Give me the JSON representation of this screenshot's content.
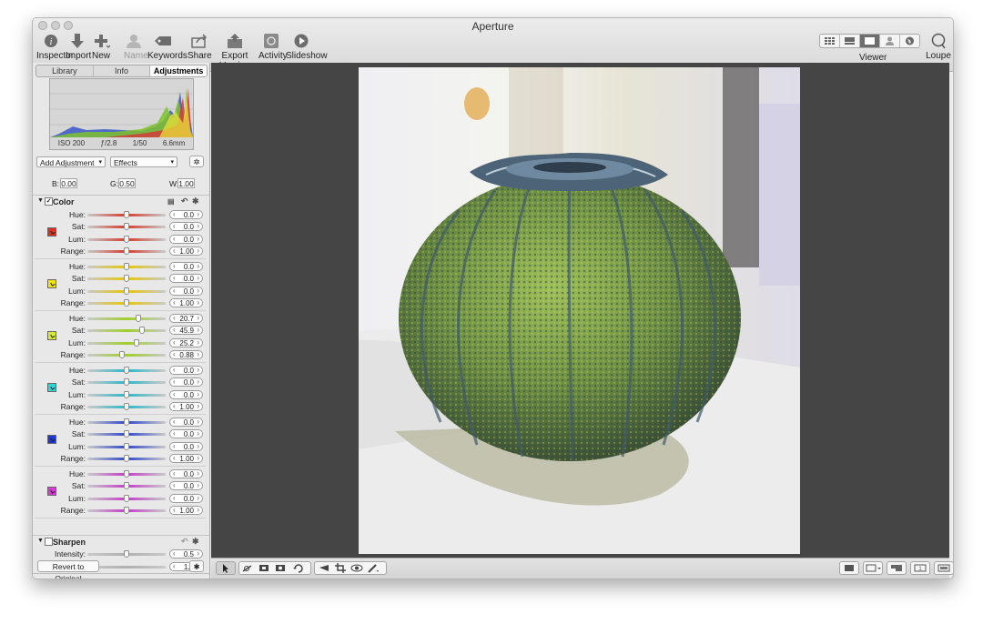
{
  "window": {
    "title": "Aperture"
  },
  "toolbar": {
    "left_items": [
      {
        "label": "Inspector",
        "icon": "info-icon"
      },
      {
        "label": "Import",
        "icon": "import-arrow-icon"
      },
      {
        "label": "New",
        "icon": "plus-icon"
      },
      {
        "label": "Name",
        "icon": "person-icon"
      },
      {
        "label": "Keywords",
        "icon": "tag-icon"
      }
    ],
    "right_items": [
      {
        "label": "Share",
        "icon": "share-icon"
      },
      {
        "label": "Export Version",
        "icon": "export-icon"
      },
      {
        "label": "Activity",
        "icon": "activity-icon"
      },
      {
        "label": "Slideshow",
        "icon": "play-icon"
      }
    ],
    "viewer_label": "Viewer",
    "loupe_label": "Loupe"
  },
  "inspector": {
    "tabs": [
      "Library",
      "Info",
      "Adjustments"
    ],
    "selected_tab": "Adjustments",
    "histogram": {
      "iso": "ISO 200",
      "aperture": "ƒ/2.8",
      "shutter": "1/50",
      "focal": "6.6mm"
    },
    "add_adjustment": "Add Adjustment",
    "effects": "Effects",
    "white_balance": {
      "b_label": "B:",
      "b": "0.00",
      "g_label": "G:",
      "g": "0.50",
      "w_label": "W:",
      "w": "1.00"
    },
    "color_section": {
      "title": "Color",
      "groups": [
        {
          "swatch": "#e0301e",
          "track": "#d43c2c",
          "rows": [
            {
              "name": "Hue:",
              "value": "0.0",
              "pos": 0.5
            },
            {
              "name": "Sat:",
              "value": "0.0",
              "pos": 0.5
            },
            {
              "name": "Lum:",
              "value": "0.0",
              "pos": 0.5
            },
            {
              "name": "Range:",
              "value": "1.00",
              "pos": 0.5
            }
          ]
        },
        {
          "swatch": "#f2e500",
          "track": "#e6c600",
          "rows": [
            {
              "name": "Hue:",
              "value": "0.0",
              "pos": 0.5
            },
            {
              "name": "Sat:",
              "value": "0.0",
              "pos": 0.5
            },
            {
              "name": "Lum:",
              "value": "0.0",
              "pos": 0.5
            },
            {
              "name": "Range:",
              "value": "1.00",
              "pos": 0.5
            }
          ]
        },
        {
          "swatch": "#d8ec2c",
          "track": "#9fcf2a",
          "rows": [
            {
              "name": "Hue:",
              "value": "20.7",
              "pos": 0.65
            },
            {
              "name": "Sat:",
              "value": "45.9",
              "pos": 0.7
            },
            {
              "name": "Lum:",
              "value": "25.2",
              "pos": 0.63
            },
            {
              "name": "Range:",
              "value": "0.88",
              "pos": 0.44
            }
          ]
        },
        {
          "swatch": "#2fd6d6",
          "track": "#2bb7c8",
          "rows": [
            {
              "name": "Hue:",
              "value": "0.0",
              "pos": 0.5
            },
            {
              "name": "Sat:",
              "value": "0.0",
              "pos": 0.5
            },
            {
              "name": "Lum:",
              "value": "0.0",
              "pos": 0.5
            },
            {
              "name": "Range:",
              "value": "1.00",
              "pos": 0.5
            }
          ]
        },
        {
          "swatch": "#1f37d8",
          "track": "#3048c8",
          "rows": [
            {
              "name": "Hue:",
              "value": "0.0",
              "pos": 0.5
            },
            {
              "name": "Sat:",
              "value": "0.0",
              "pos": 0.5
            },
            {
              "name": "Lum:",
              "value": "0.0",
              "pos": 0.5
            },
            {
              "name": "Range:",
              "value": "1.00",
              "pos": 0.5
            }
          ]
        },
        {
          "swatch": "#d83ad8",
          "track": "#c23ec8",
          "rows": [
            {
              "name": "Hue:",
              "value": "0.0",
              "pos": 0.5
            },
            {
              "name": "Sat:",
              "value": "0.0",
              "pos": 0.5
            },
            {
              "name": "Lum:",
              "value": "0.0",
              "pos": 0.5
            },
            {
              "name": "Range:",
              "value": "1.00",
              "pos": 0.5
            }
          ]
        }
      ]
    },
    "sharpen_section": {
      "title": "Sharpen",
      "rows": [
        {
          "name": "Intensity:",
          "value": "0.5",
          "pos": 0.5
        },
        {
          "name": "Radius:",
          "value": "1.0",
          "pos": 0.04
        }
      ]
    },
    "revert_button": "Revert to Original"
  }
}
